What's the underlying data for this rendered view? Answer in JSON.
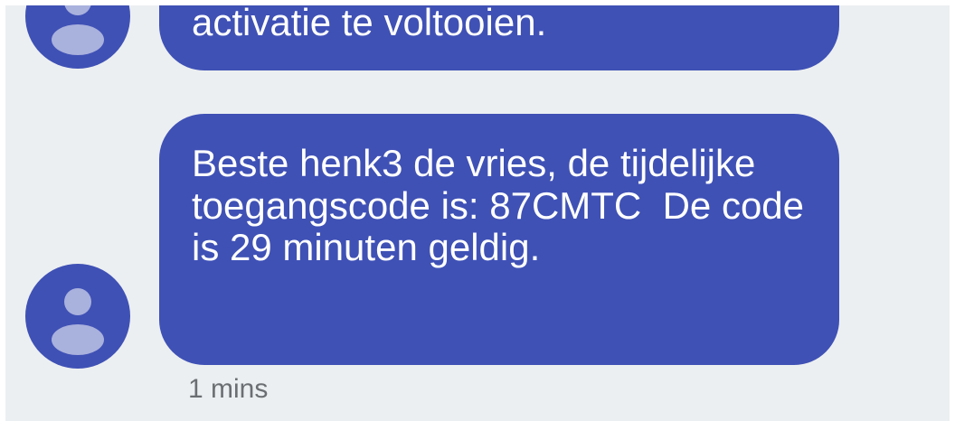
{
  "messages": [
    {
      "text": "activatie te voltooien.",
      "avatar_icon": "person-icon"
    },
    {
      "text": "Beste henk3 de vries, de tijdelijke toegangscode is: 87CMTC  De code is 29 minuten geldig.",
      "avatar_icon": "person-icon",
      "timestamp": "1 mins"
    }
  ],
  "colors": {
    "bubble": "#3f51b5",
    "avatar_background": "#3f51b5",
    "avatar_figure": "#a9b1dd",
    "background": "#eceff1",
    "timestamp": "#6b6f73"
  }
}
